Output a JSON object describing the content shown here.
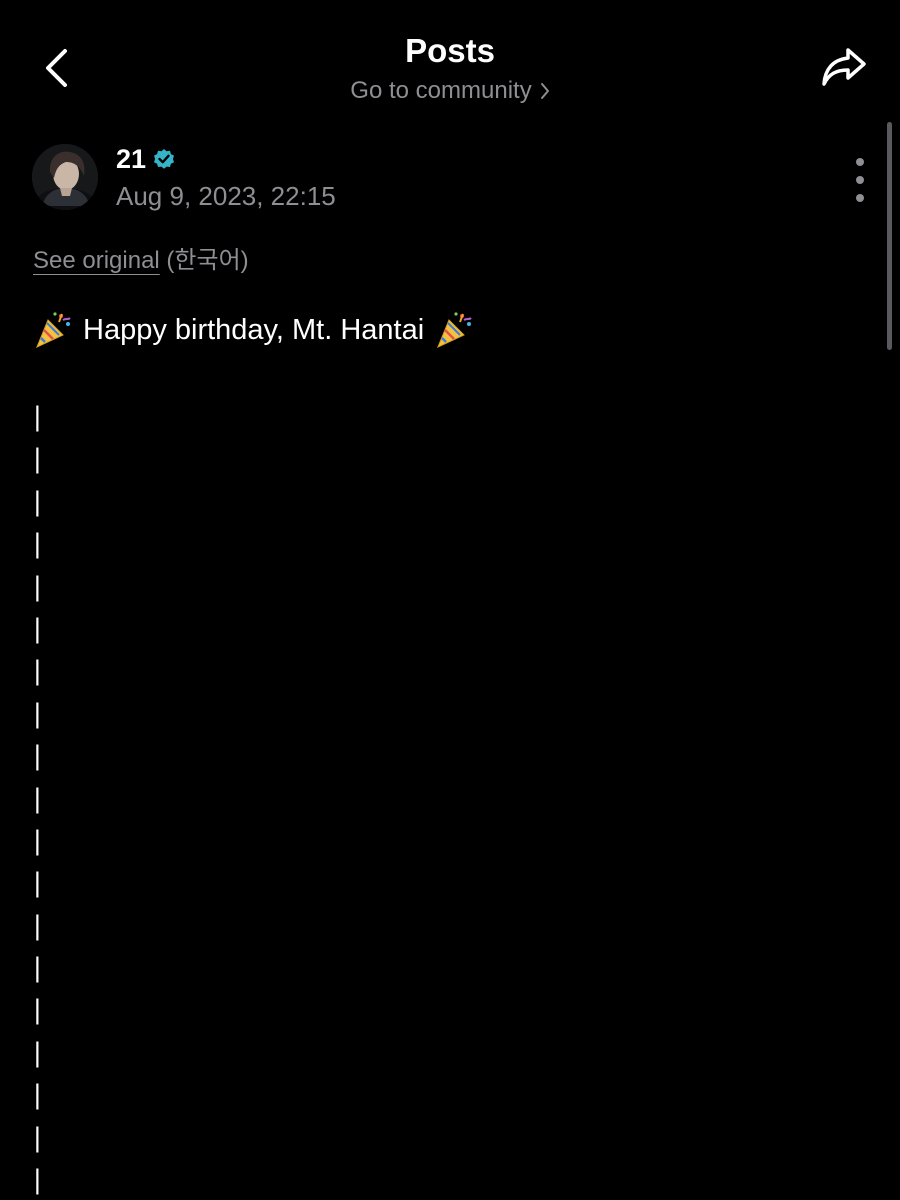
{
  "header": {
    "title": "Posts",
    "community_link": "Go to community"
  },
  "author": {
    "name": "21",
    "verified": true,
    "timestamp": "Aug 9, 2023, 22:15"
  },
  "translation": {
    "see_original": "See original",
    "language": "(한국어)"
  },
  "post": {
    "text": "Happy birthday, Mt. Hantai",
    "bars": [
      "|",
      "|",
      "|",
      "|",
      "|",
      "|",
      "|",
      "|",
      "|",
      "|",
      "|",
      "|",
      "|",
      "|",
      "|",
      "|",
      "|",
      "|",
      "|"
    ]
  },
  "colors": {
    "background": "#000000",
    "text_primary": "#ffffff",
    "text_secondary": "#8e8e93",
    "verified_badge": "#35b4c8"
  },
  "icons": {
    "back": "chevron-left-icon",
    "share": "share-arrow-icon",
    "more": "more-vertical-icon",
    "verified": "verified-badge-icon",
    "party": "party-popper-icon"
  }
}
